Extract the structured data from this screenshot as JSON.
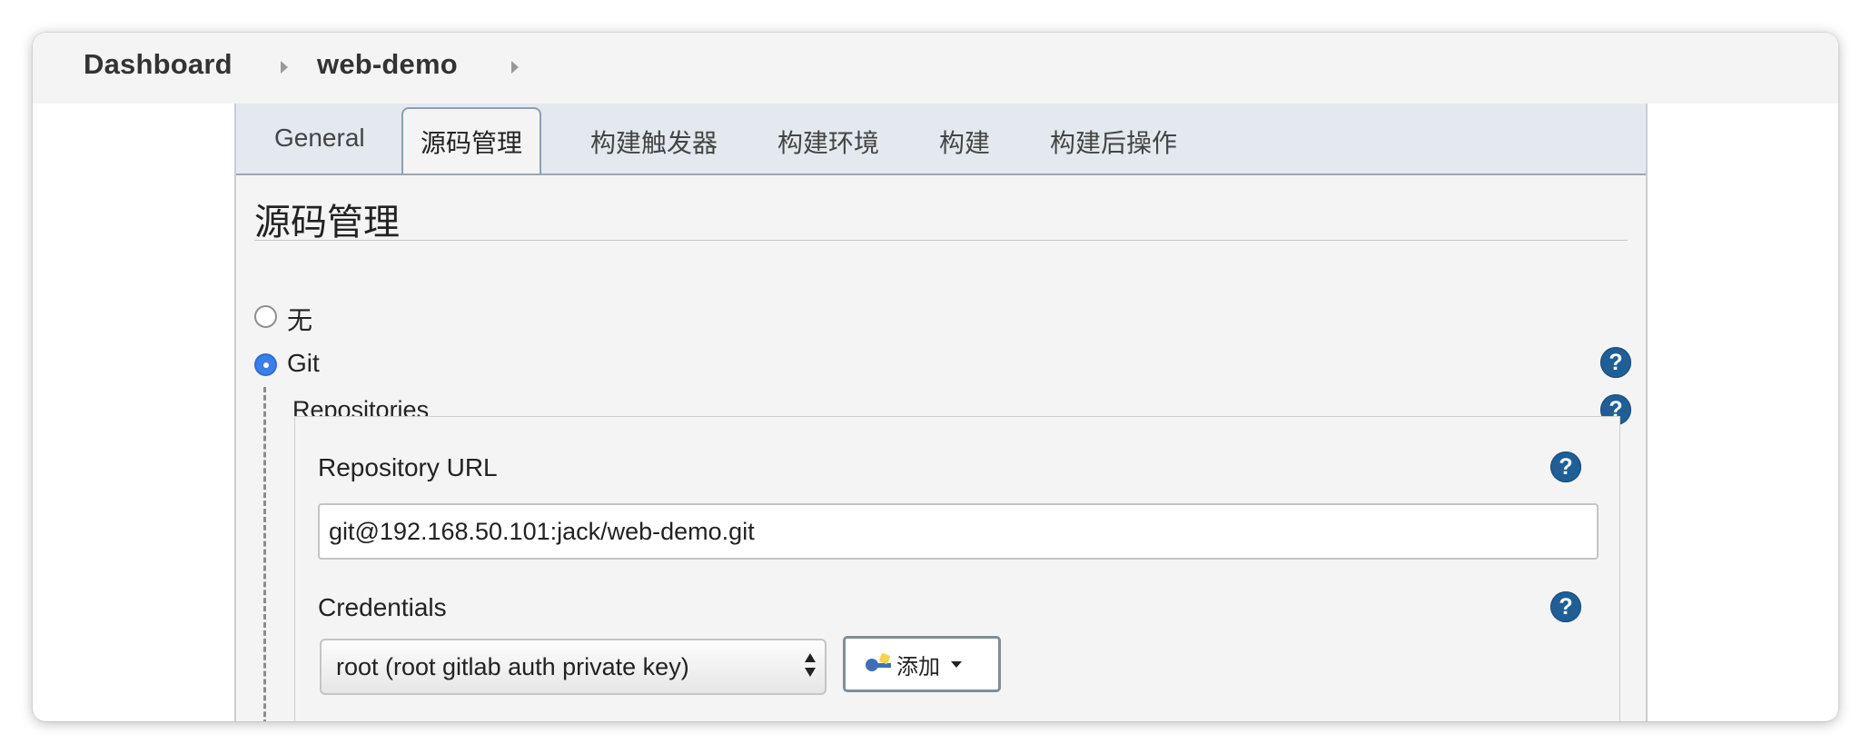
{
  "breadcrumb": {
    "items": [
      "Dashboard",
      "web-demo"
    ]
  },
  "tabs": [
    "General",
    "源码管理",
    "构建触发器",
    "构建环境",
    "构建",
    "构建后操作"
  ],
  "active_tab_index": 1,
  "section": {
    "title": "源码管理"
  },
  "scm_options": {
    "none_label": "无",
    "git_label": "Git",
    "selected": "Git"
  },
  "repositories": {
    "label": "Repositories",
    "url_label": "Repository URL",
    "url_value": "git@192.168.50.101:jack/web-demo.git",
    "credentials_label": "Credentials",
    "credentials_selected": "root (root gitlab auth private key)",
    "add_button_label": "添加"
  },
  "help_glyph": "?",
  "icons": {
    "help": "help-icon",
    "key": "key-icon",
    "separator": "chevron-right-icon",
    "dropdown": "caret-down-icon"
  },
  "colors": {
    "help_icon_bg": "#1f5f96",
    "radio_selected": "#3b7de9",
    "tabbar_bg": "#e4e9ef"
  }
}
